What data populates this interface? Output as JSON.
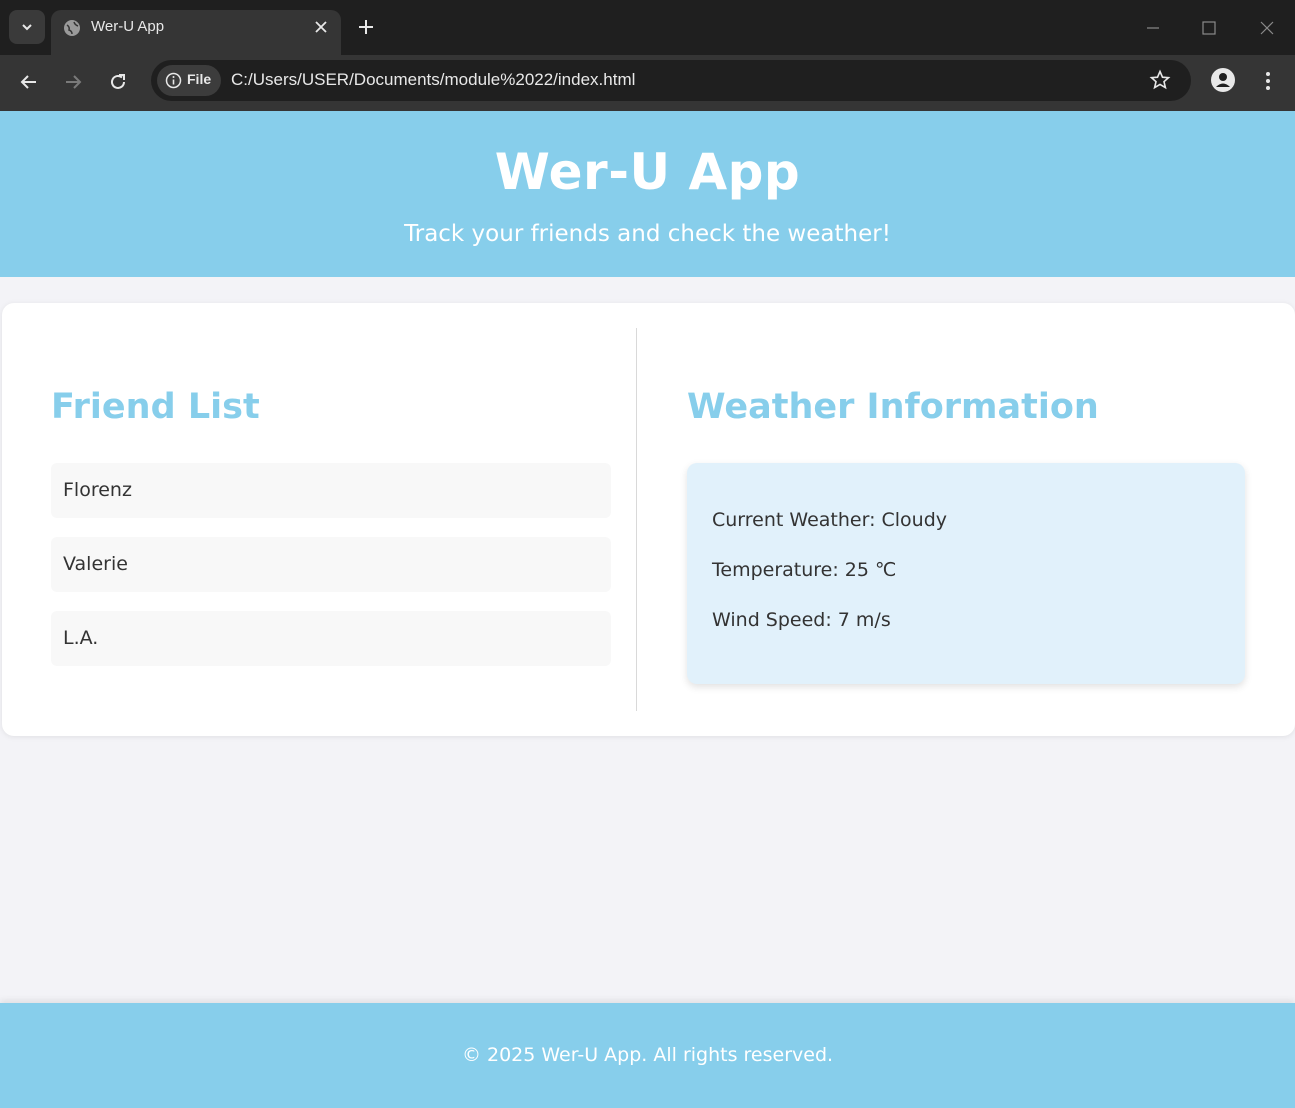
{
  "browser": {
    "tab_title": "Wer-U App",
    "chip_label": "File",
    "url": "C:/Users/USER/Documents/module%2022/index.html"
  },
  "header": {
    "title": "Wer-U App",
    "subtitle": "Track your friends and check the weather!"
  },
  "friends": {
    "title": "Friend List",
    "items": [
      "Florenz",
      "Valerie",
      "L.A."
    ]
  },
  "weather": {
    "title": "Weather Information",
    "current": "Current Weather: Cloudy",
    "temperature": "Temperature: 25 ℃",
    "wind": "Wind Speed: 7 m/s"
  },
  "footer": {
    "text": "© 2025 Wer-U App. All rights reserved."
  },
  "colors": {
    "accent": "#87ceeb",
    "weather_box": "#e1f1fb",
    "page_bg": "#f3f3f7"
  }
}
